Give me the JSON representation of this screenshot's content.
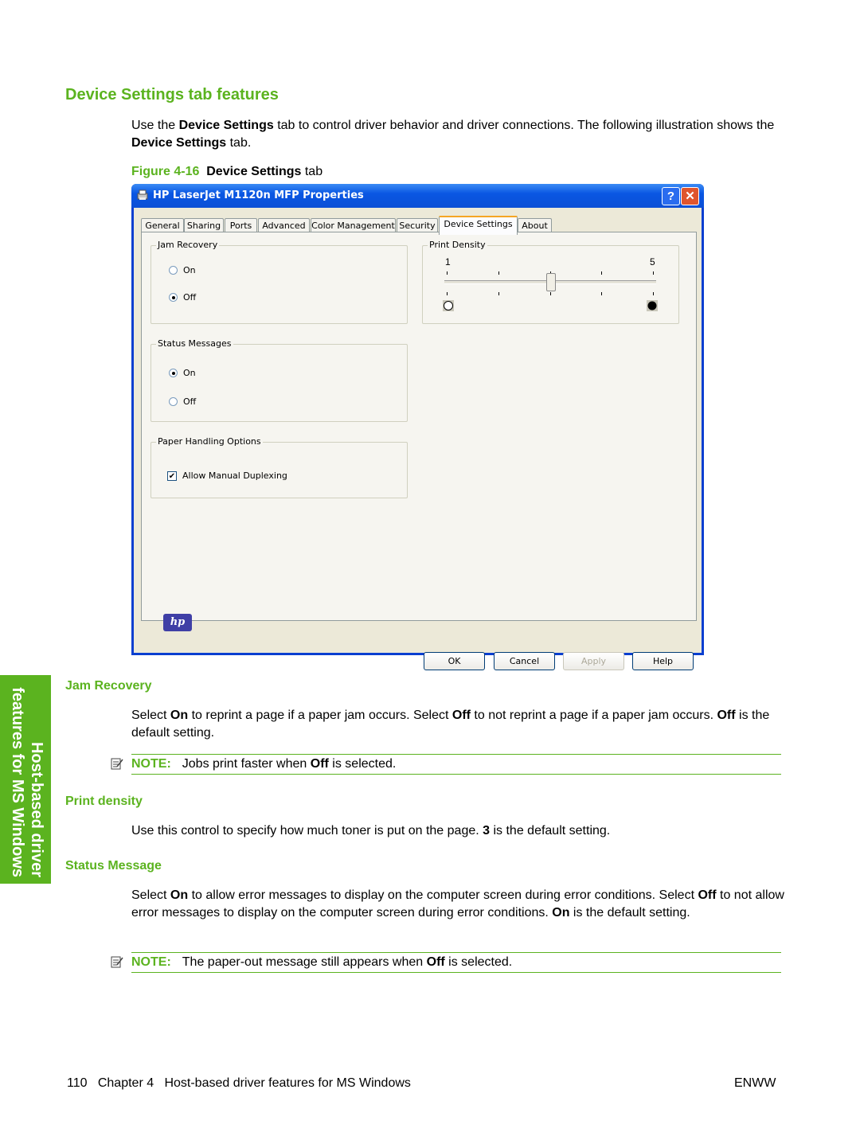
{
  "page": {
    "heading": "Device Settings tab features",
    "intro_1": "Use the ",
    "intro_bold_1": "Device Settings",
    "intro_2": " tab to control driver behavior and driver connections. The following illustration shows the ",
    "intro_bold_2": "Device Settings",
    "intro_3": " tab.",
    "figure_number": "Figure 4-16",
    "figure_bold": "Device Settings",
    "figure_rest": " tab"
  },
  "dialog": {
    "title": "HP LaserJet M1120n MFP Properties",
    "help_glyph": "?",
    "close_glyph": "✕",
    "tabs": [
      {
        "label": "General"
      },
      {
        "label": "Sharing"
      },
      {
        "label": "Ports"
      },
      {
        "label": "Advanced"
      },
      {
        "label": "Color Management"
      },
      {
        "label": "Security"
      },
      {
        "label": "Device Settings",
        "active": true
      },
      {
        "label": "About"
      }
    ],
    "jam_recovery": {
      "label": "Jam Recovery",
      "on": "On",
      "off": "Off",
      "selected": "Off"
    },
    "status_messages": {
      "label": "Status Messages",
      "on": "On",
      "off": "Off",
      "selected": "On"
    },
    "paper_handling": {
      "label": "Paper Handling Options",
      "checkbox_label": "Allow Manual Duplexing",
      "checked": true
    },
    "print_density": {
      "label": "Print Density",
      "min_label": "1",
      "max_label": "5",
      "min": 1,
      "max": 5,
      "value": 3
    },
    "logo": "hp",
    "buttons": {
      "ok": "OK",
      "cancel": "Cancel",
      "apply": "Apply",
      "help": "Help"
    }
  },
  "sections": {
    "jam": {
      "heading": "Jam Recovery",
      "t1": "Select ",
      "b1": "On",
      "t2": " to reprint a page if a paper jam occurs. Select ",
      "b2": "Off",
      "t3": " to not reprint a page if a paper jam occurs. ",
      "b3": "Off",
      "t4": " is the default setting.",
      "note_label": "NOTE:",
      "note_t1": "Jobs print faster when ",
      "note_b1": "Off",
      "note_t2": " is selected."
    },
    "density": {
      "heading": "Print density",
      "t1": "Use this control to specify how much toner is put on the page. ",
      "b1": "3",
      "t2": " is the default setting."
    },
    "status": {
      "heading": "Status Message",
      "t1": "Select ",
      "b1": "On",
      "t2": " to allow error messages to display on the computer screen during error conditions. Select ",
      "b2": "Off",
      "t3": " to not allow error messages to display on the computer screen during error conditions. ",
      "b3": "On",
      "t4": " is the default setting.",
      "note_label": "NOTE:",
      "note_t1": "The paper-out message still appears when ",
      "note_b1": "Off",
      "note_t2": " is selected."
    }
  },
  "side_tab": {
    "line1": "Host-based driver",
    "line2": "features for MS Windows"
  },
  "footer": {
    "left": "110   Chapter 4   Host-based driver features for MS Windows",
    "right": "ENWW"
  },
  "colors": {
    "accent": "#5bb31f",
    "title_bar": "#0a57e3",
    "dialog_bg": "#ece9d8"
  }
}
